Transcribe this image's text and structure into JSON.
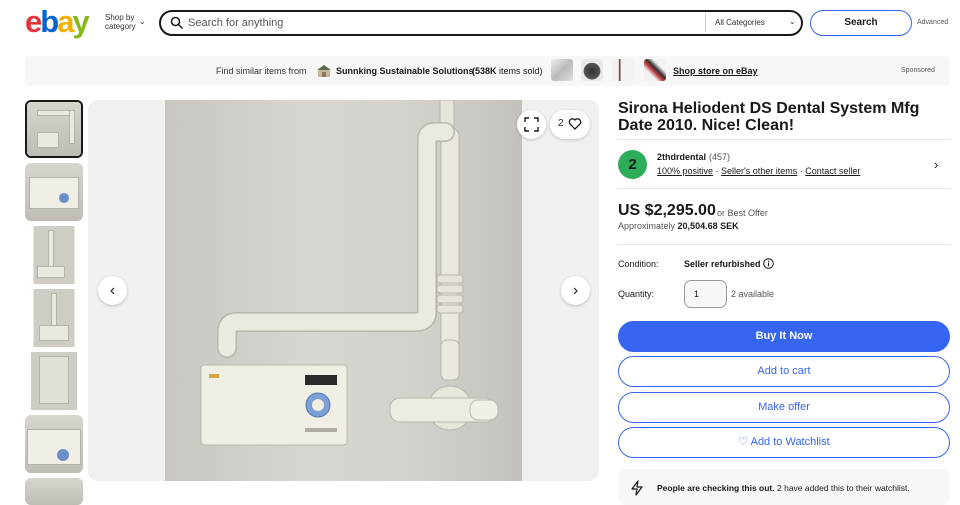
{
  "header": {
    "logo_letters": [
      "e",
      "b",
      "a",
      "y"
    ],
    "logo_colors": [
      "#e53238",
      "#0064d2",
      "#f5af02",
      "#86b817"
    ],
    "shop_by_category": "Shop by category",
    "search_placeholder": "Search for anything",
    "category_select": "All Categories",
    "search_button": "Search",
    "advanced_link": "Advanced"
  },
  "banner": {
    "find_text": "Find similar items from",
    "store_name": "Sunnking Sustainable Solutions",
    "sold_count": "(538K",
    "sold_suffix": "items sold)",
    "shop_store_link": "Shop store on eBay",
    "sponsored": "Sponsored"
  },
  "gallery": {
    "thumbnail_count": 7,
    "selected_index": 0,
    "watch_count": "2"
  },
  "listing": {
    "title": "Sirona Heliodent DS Dental System Mfg Date 2010. Nice! Clean!",
    "seller": {
      "badge": "2",
      "name": "2thdrdental",
      "feedback_count": "(457)",
      "positive": "100% positive",
      "other_items": "Seller's other items",
      "contact": "Contact seller"
    },
    "price": "US $2,295.00",
    "or_best_offer": "or Best Offer",
    "approx_label": "Approximately",
    "approx_value": "20,504.68 SEK",
    "condition_label": "Condition:",
    "condition_value": "Seller refurbished",
    "quantity_label": "Quantity:",
    "quantity_value": "1",
    "available": "2 available",
    "buttons": {
      "buy_now": "Buy It Now",
      "add_cart": "Add to cart",
      "make_offer": "Make offer",
      "watchlist": "♡ Add to Watchlist"
    },
    "notice": {
      "bold": "People are checking this out.",
      "rest": "2 have added this to their watchlist."
    }
  },
  "colors": {
    "accent_blue": "#3665f3",
    "seller_green": "#2eae5a"
  }
}
